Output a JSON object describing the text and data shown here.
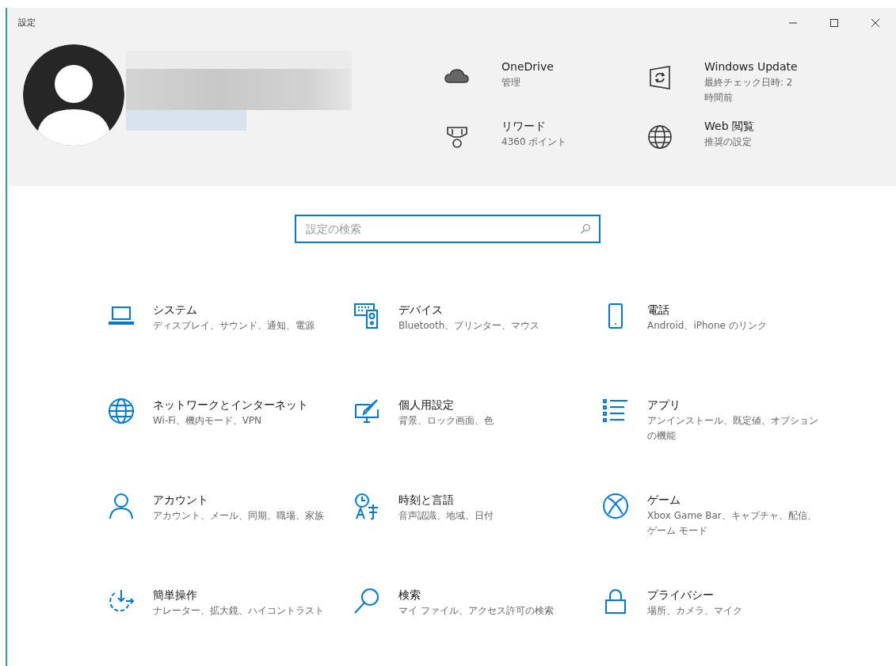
{
  "window": {
    "title": "設定"
  },
  "header_links": [
    {
      "title": "OneDrive",
      "subtitle": "管理"
    },
    {
      "title": "Windows Update",
      "subtitle": "最終チェック日時: 2 時間前"
    },
    {
      "title": "リワード",
      "subtitle": "4360 ポイント"
    },
    {
      "title": "Web 閲覧",
      "subtitle": "推奨の設定"
    }
  ],
  "search": {
    "placeholder": "設定の検索"
  },
  "categories": [
    {
      "title": "システム",
      "description": "ディスプレイ、サウンド、通知、電源"
    },
    {
      "title": "デバイス",
      "description": "Bluetooth、プリンター、マウス"
    },
    {
      "title": "電話",
      "description": "Android、iPhone のリンク"
    },
    {
      "title": "ネットワークとインターネット",
      "description": "Wi-Fi、機内モード、VPN"
    },
    {
      "title": "個人用設定",
      "description": "背景、ロック画面、色"
    },
    {
      "title": "アプリ",
      "description": "アンインストール、既定値、オプションの機能"
    },
    {
      "title": "アカウント",
      "description": "アカウント、メール、同期、職場、家族"
    },
    {
      "title": "時刻と言語",
      "description": "音声認識、地域、日付"
    },
    {
      "title": "ゲーム",
      "description": "Xbox Game Bar、キャプチャ、配信、ゲーム モード"
    },
    {
      "title": "簡単操作",
      "description": "ナレーター、拡大鏡、ハイコントラスト"
    },
    {
      "title": "検索",
      "description": "マイ ファイル、アクセス許可の検索"
    },
    {
      "title": "プライバシー",
      "description": "場所、カメラ、マイク"
    }
  ]
}
